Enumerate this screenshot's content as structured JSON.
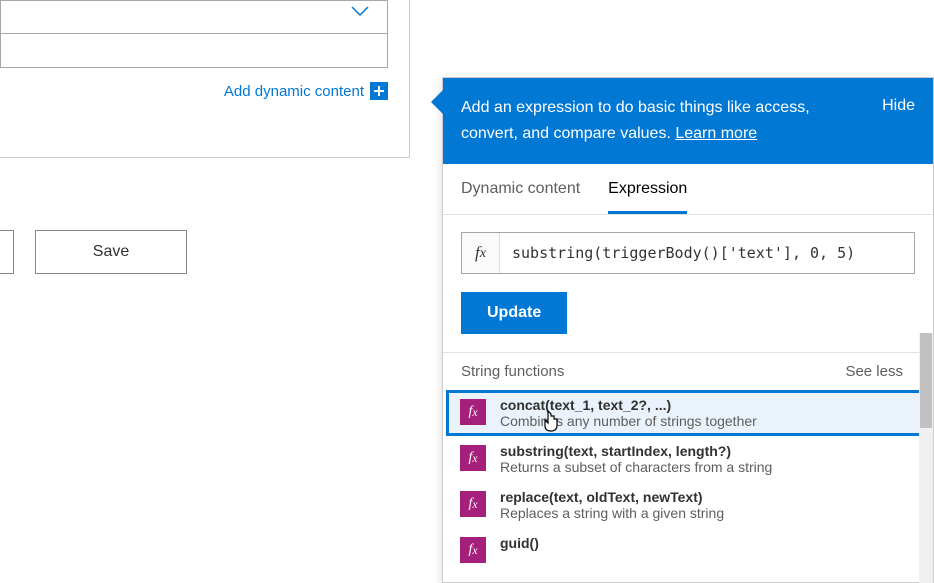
{
  "left": {
    "add_dynamic_content": "Add dynamic content",
    "save_label": "Save"
  },
  "panel": {
    "header_text_a": "Add an expression to do basic things like access, convert, and compare values. ",
    "header_learn_more": "Learn more",
    "hide": "Hide",
    "tabs": {
      "dynamic": "Dynamic content",
      "expression": "Expression"
    },
    "expr_value": "substring(triggerBody()['text'], 0, 5)",
    "update": "Update",
    "section_title": "String functions",
    "see_less": "See less",
    "functions": [
      {
        "title": "concat(text_1, text_2?, ...)",
        "desc": "Combines any number of strings together",
        "selected": true
      },
      {
        "title": "substring(text, startIndex, length?)",
        "desc": "Returns a subset of characters from a string",
        "selected": false
      },
      {
        "title": "replace(text, oldText, newText)",
        "desc": "Replaces a string with a given string",
        "selected": false
      },
      {
        "title": "guid()",
        "desc": "",
        "selected": false
      }
    ]
  }
}
